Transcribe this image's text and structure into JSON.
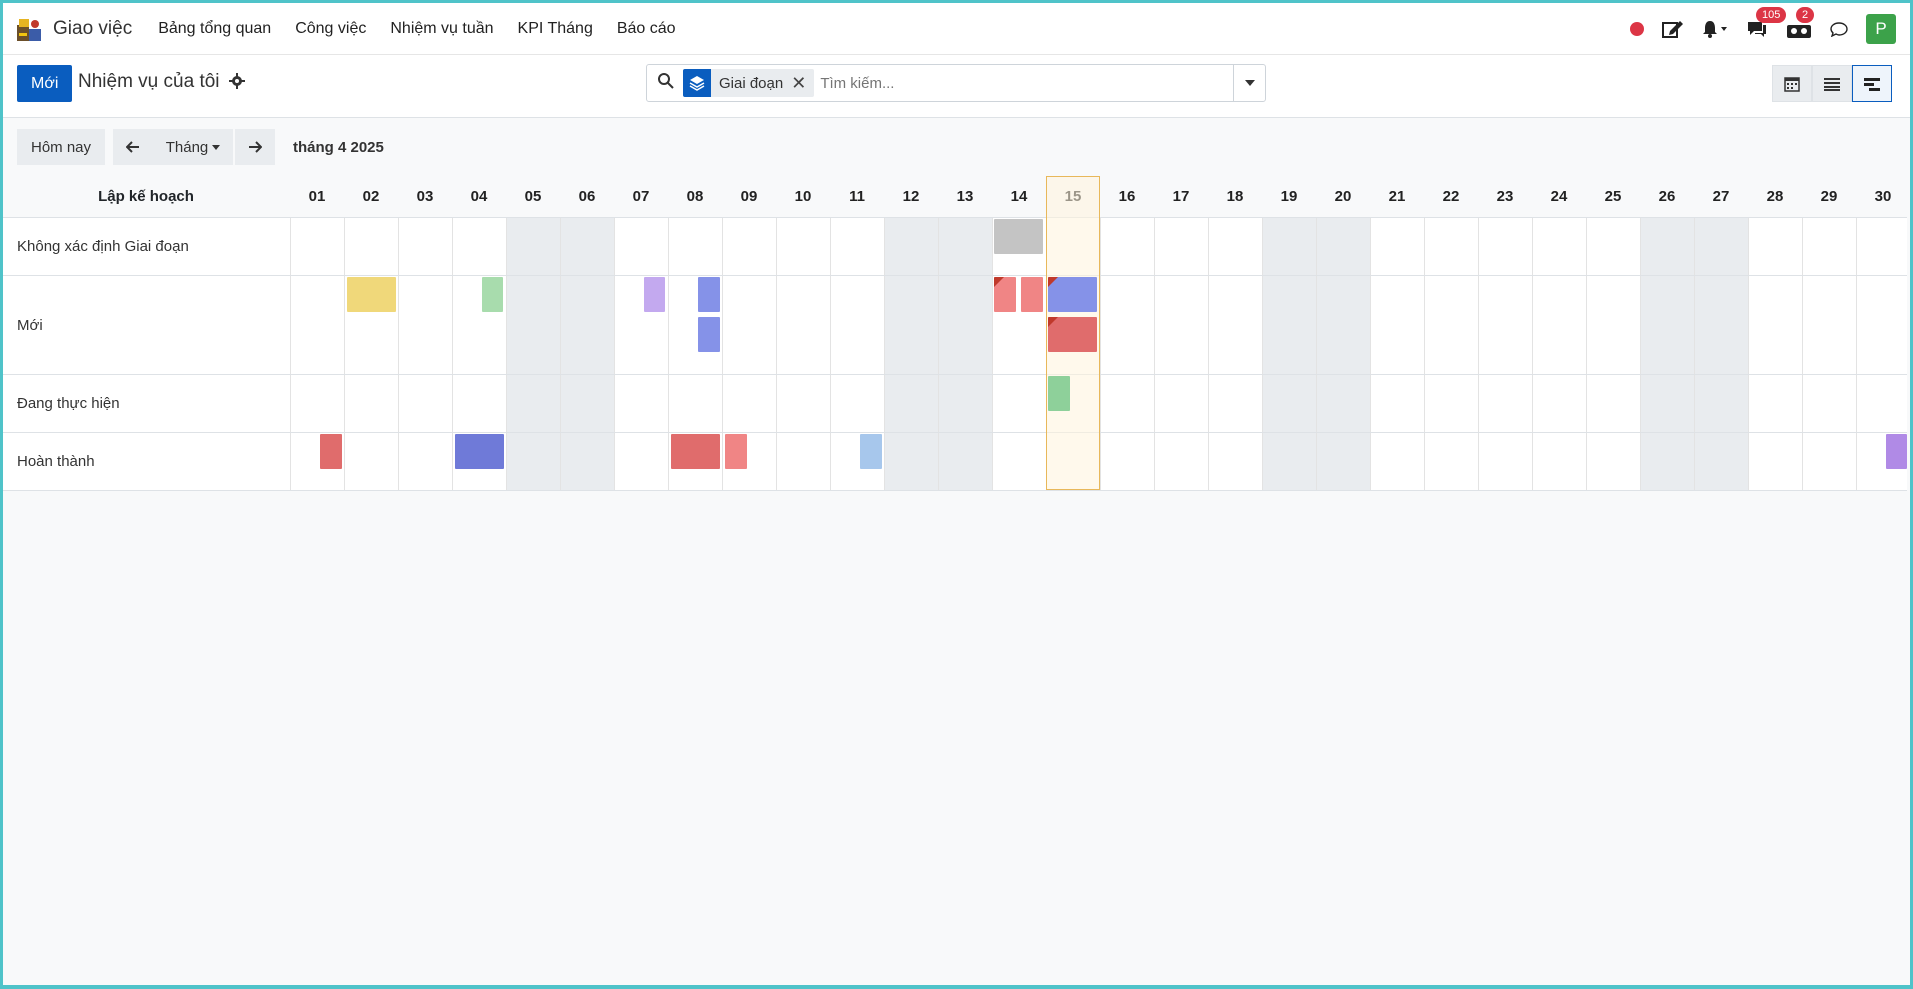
{
  "app": {
    "name": "Giao việc"
  },
  "menu": [
    "Bảng tổng quan",
    "Công việc",
    "Nhiệm vụ tuần",
    "KPI Tháng",
    "Báo cáo"
  ],
  "systray": {
    "messages_count": "105",
    "activity_count": "2",
    "avatar_letter": "P"
  },
  "control": {
    "new_label": "Mới",
    "title": "Nhiệm vụ của tôi",
    "facet_label": "Giai đoạn",
    "search_placeholder": "Tìm kiếm..."
  },
  "gantt_toolbar": {
    "today": "Hôm nay",
    "scale": "Tháng",
    "range": "tháng 4 2025"
  },
  "gantt": {
    "header_title": "Lập kế hoạch",
    "days": [
      "01",
      "02",
      "03",
      "04",
      "05",
      "06",
      "07",
      "08",
      "09",
      "10",
      "11",
      "12",
      "13",
      "14",
      "15",
      "16",
      "17",
      "18",
      "19",
      "20",
      "21",
      "22",
      "23",
      "24",
      "25",
      "26",
      "27",
      "28",
      "29",
      "30"
    ],
    "weekend_days": [
      "05",
      "06",
      "12",
      "13",
      "19",
      "20",
      "26",
      "27"
    ],
    "today": "15",
    "rows": [
      {
        "label": "Không xác định Giai đoạn"
      },
      {
        "label": "Mới"
      },
      {
        "label": "Đang thực hiện"
      },
      {
        "label": "Hoàn thành"
      }
    ]
  },
  "colors": {
    "primary": "#0a5dbf",
    "today_border": "#e8b85a",
    "danger": "#dc3545"
  }
}
